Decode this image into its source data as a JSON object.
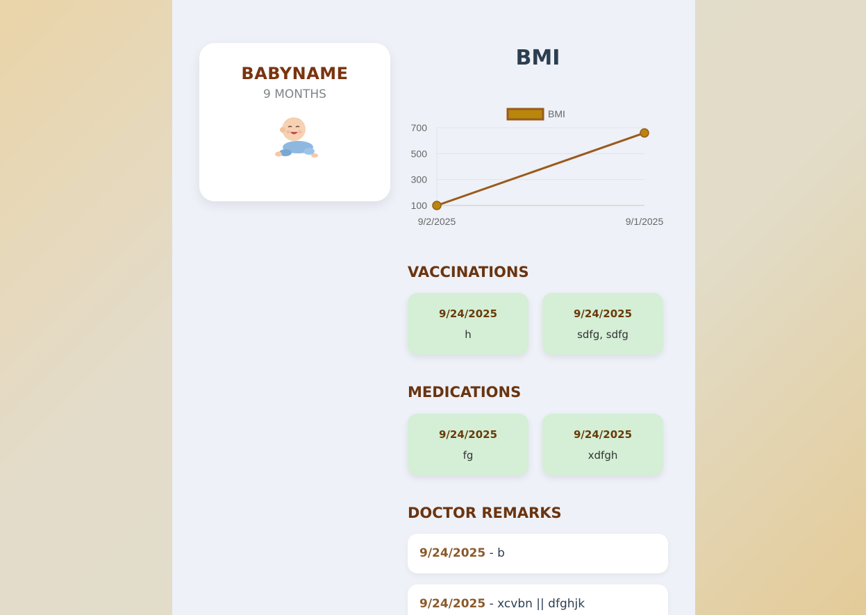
{
  "profile": {
    "name": "BABYNAME",
    "age": "9 MONTHS"
  },
  "bmi": {
    "title": "BMI"
  },
  "chart_data": {
    "type": "line",
    "x": [
      "9/2/2025",
      "9/1/2025"
    ],
    "series": [
      {
        "name": "BMI",
        "values": [
          100,
          660
        ]
      }
    ],
    "ylim": [
      100,
      700
    ],
    "yticks": [
      100,
      300,
      500,
      700
    ],
    "legend": "top",
    "grid": true,
    "colors": {
      "line": "#9a5a1c",
      "point": "#b8860b",
      "legend_fill": "#b8860b",
      "legend_border": "#9a5a1c"
    }
  },
  "vaccinations": {
    "title": "VACCINATIONS",
    "items": [
      {
        "date": "9/24/2025",
        "text": "h"
      },
      {
        "date": "9/24/2025",
        "text": "sdfg, sdfg"
      }
    ]
  },
  "medications": {
    "title": "MEDICATIONS",
    "items": [
      {
        "date": "9/24/2025",
        "text": "fg"
      },
      {
        "date": "9/24/2025",
        "text": "xdfgh"
      }
    ]
  },
  "remarks": {
    "title": "DOCTOR REMARKS",
    "items": [
      {
        "date": "9/24/2025",
        "sep": " - ",
        "text": "b"
      },
      {
        "date": "9/24/2025",
        "sep": " - ",
        "text": "xcvbn || dfghjk"
      }
    ]
  }
}
